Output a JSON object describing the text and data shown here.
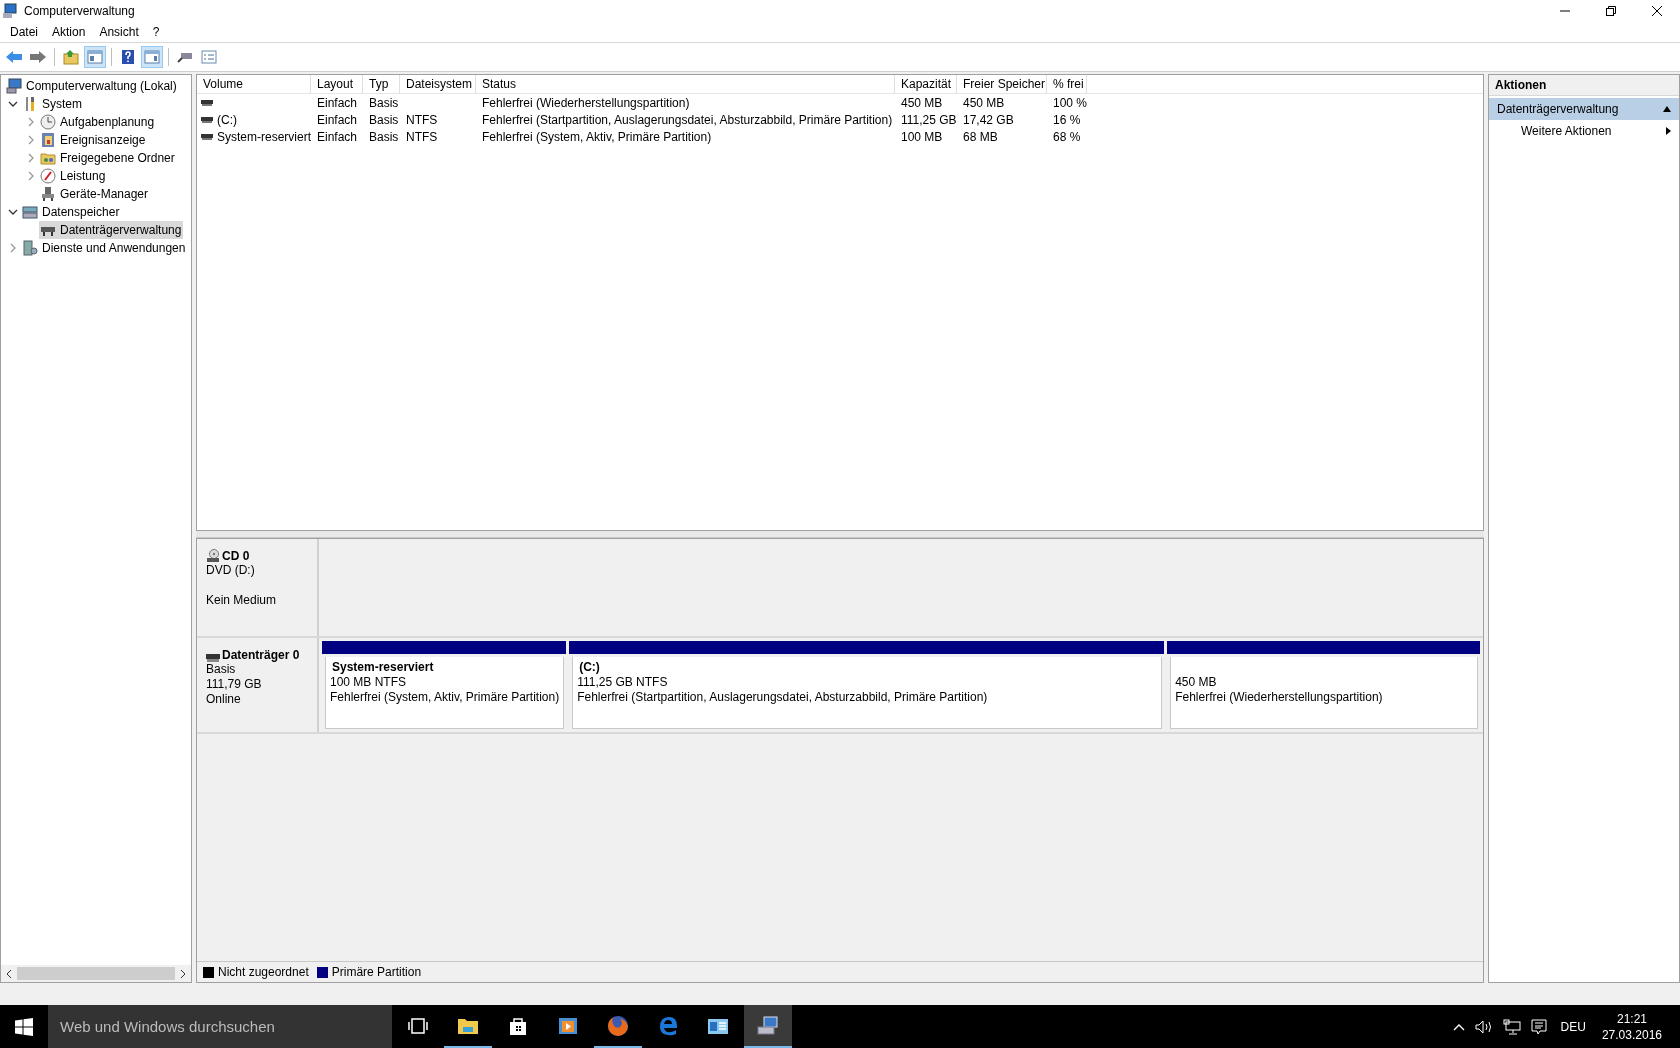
{
  "window": {
    "title": "Computerverwaltung"
  },
  "menu": [
    "Datei",
    "Aktion",
    "Ansicht",
    "?"
  ],
  "toolbar": [
    {
      "pressed": false
    },
    {
      "pressed": false
    },
    {
      "pressed": false
    },
    {
      "pressed": true
    },
    {
      "pressed": false
    },
    {
      "pressed": true
    },
    {
      "pressed": false
    },
    {
      "pressed": false
    }
  ],
  "tree": [
    {
      "label": "Computerverwaltung (Lokal)",
      "selected": false,
      "children": [
        {
          "label": "System",
          "expanded": true,
          "selected": false,
          "children": [
            {
              "label": "Aufgabenplanung",
              "expanded": false,
              "selected": false
            },
            {
              "label": "Ereignisanzeige",
              "expanded": false,
              "selected": false
            },
            {
              "label": "Freigegebene Ordner",
              "expanded": false,
              "selected": false
            },
            {
              "label": "Leistung",
              "expanded": false,
              "selected": false
            },
            {
              "label": "Geräte-Manager",
              "selected": false
            }
          ]
        },
        {
          "label": "Datenspeicher",
          "expanded": true,
          "selected": false,
          "children": [
            {
              "label": "Datenträgerverwaltung",
              "selected": true
            }
          ]
        },
        {
          "label": "Dienste und Anwendungen",
          "expanded": false,
          "selected": false
        }
      ]
    }
  ],
  "table": {
    "columns": [
      "Volume",
      "Layout",
      "Typ",
      "Dateisystem",
      "Status",
      "Kapazität",
      "Freier Speicher",
      "% frei"
    ],
    "rows": [
      {
        "layout": "Einfach",
        "type": "Basis",
        "status": "Fehlerfrei (Wiederherstellungspartition)",
        "capacity": "450 MB",
        "free": "450 MB",
        "percent_free": "100 %"
      },
      {
        "volume": "(C:)",
        "layout": "Einfach",
        "type": "Basis",
        "filesystem": "NTFS",
        "status": "Fehlerfrei (Startpartition, Auslagerungsdatei, Absturzabbild, Primäre Partition)",
        "capacity": "111,25 GB",
        "free": "17,42 GB",
        "percent_free": "16 %"
      },
      {
        "volume": "System-reserviert",
        "layout": "Einfach",
        "type": "Basis",
        "filesystem": "NTFS",
        "status": "Fehlerfrei (System, Aktiv, Primäre Partition)",
        "capacity": "100 MB",
        "free": "68 MB",
        "percent_free": "68 %"
      }
    ]
  },
  "disks": [
    {
      "kind": "cd",
      "name": "CD 0",
      "type": "DVD (D:)",
      "status": "Kein Medium"
    },
    {
      "kind": "disk",
      "name": "Datenträger 0",
      "details": [
        "Basis",
        "111,79 GB",
        "Online"
      ],
      "partitions": [
        {
          "name": "System-reserviert",
          "size": "100 MB NTFS",
          "status": "Fehlerfrei (System, Aktiv, Primäre Partition)",
          "color": "#000080"
        },
        {
          "name": "(C:)",
          "size": "111,25 GB NTFS",
          "status": "Fehlerfrei (Startpartition, Auslagerungsdatei, Absturzabbild, Primäre Partition)",
          "color": "#000080"
        },
        {
          "size": "450 MB",
          "status": "Fehlerfrei (Wiederherstellungspartition)",
          "color": "#000080"
        }
      ]
    }
  ],
  "legend": [
    {
      "label": "Nicht zugeordnet",
      "color": "#000000"
    },
    {
      "label": "Primäre Partition",
      "color": "#000080"
    }
  ],
  "actions": {
    "title": "Aktionen",
    "sections": [
      {
        "label": "Datenträgerverwaltung",
        "expanded": true,
        "items": [
          "Weitere Aktionen"
        ]
      }
    ]
  },
  "taskbar": {
    "search": {
      "placeholder": "Web und Windows durchsuchen"
    },
    "apps": [
      {
        "running": false,
        "selected": false
      },
      {
        "running": true,
        "selected": false
      },
      {
        "running": false,
        "selected": false
      },
      {
        "running": false,
        "selected": false
      },
      {
        "running": true,
        "selected": false
      },
      {
        "running": false,
        "selected": false
      },
      {
        "running": false,
        "selected": false
      },
      {
        "running": true,
        "selected": true
      }
    ],
    "language": "DEU",
    "time": "21:21",
    "date": "27.03.2016"
  }
}
